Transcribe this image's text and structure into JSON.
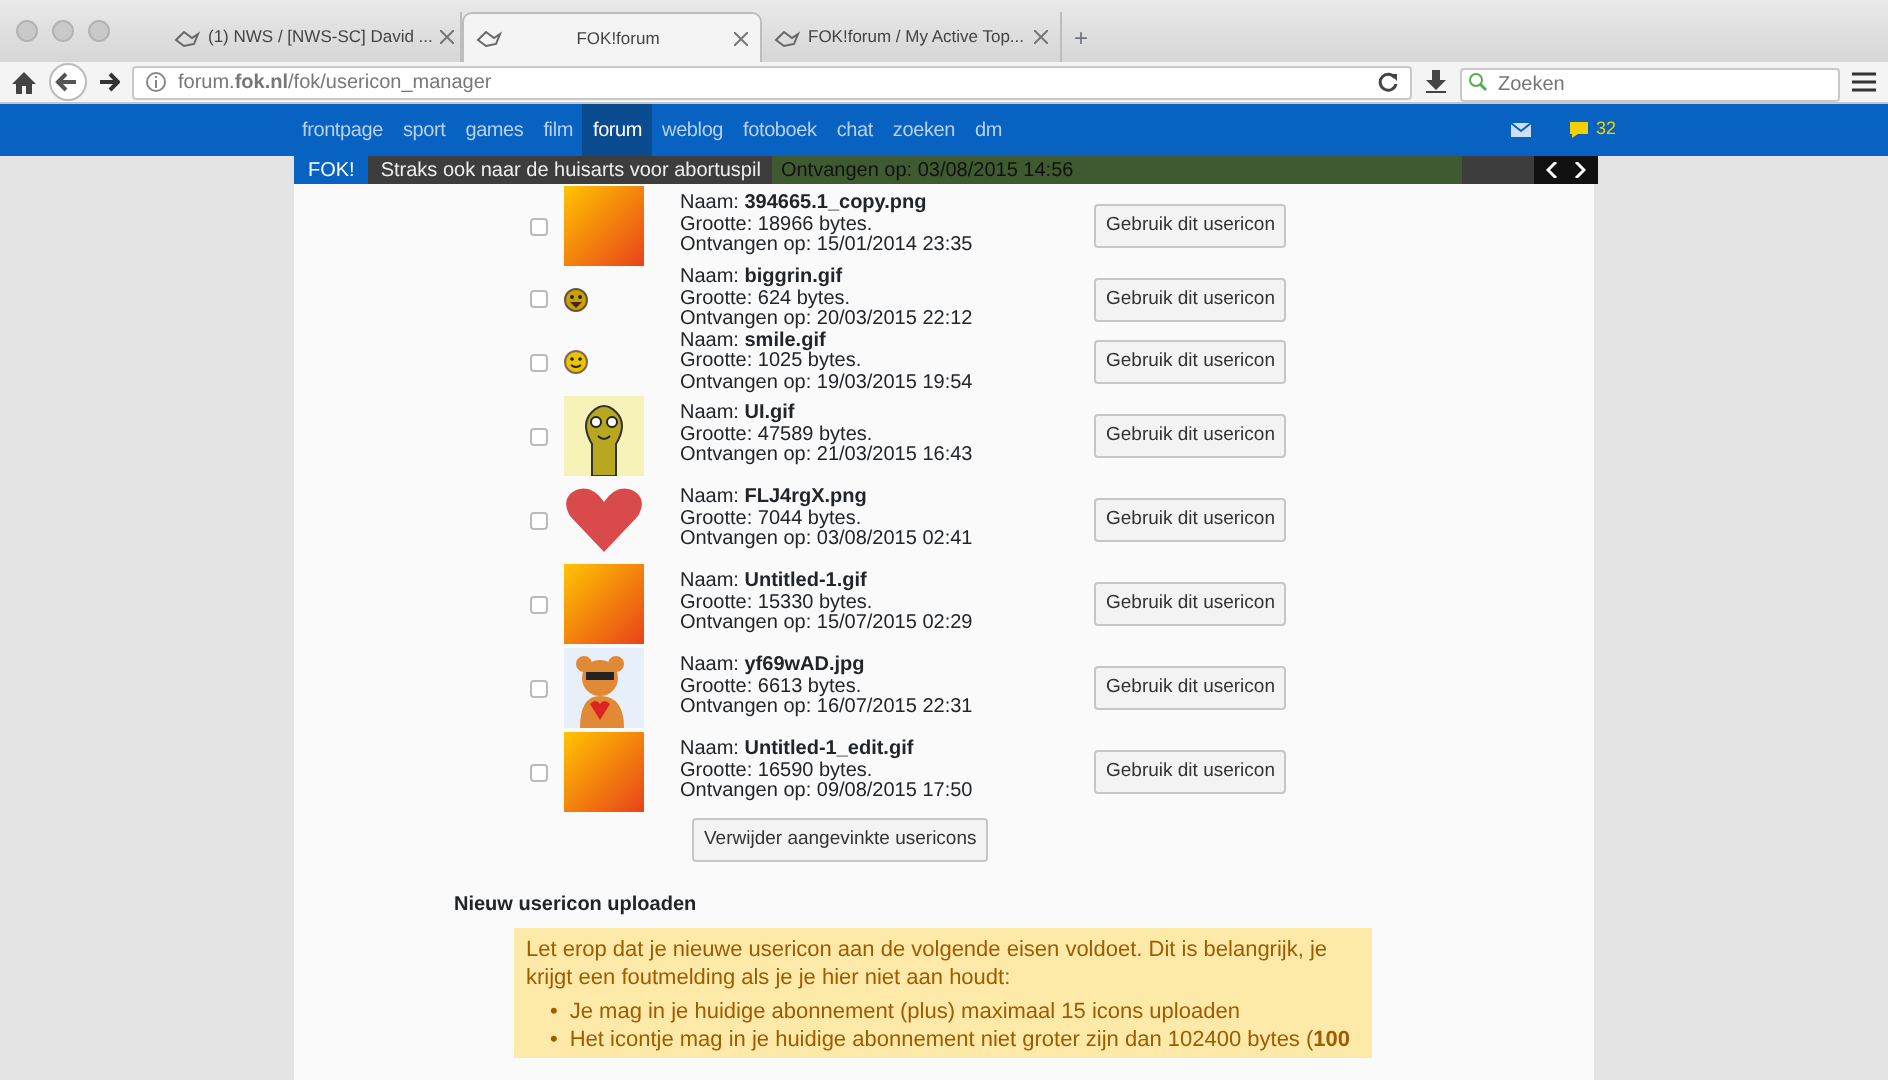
{
  "browser": {
    "tabs": [
      {
        "title": "(1) NWS / [NWS-SC] David ...",
        "selected": false
      },
      {
        "title": "FOK!forum",
        "selected": true
      },
      {
        "title": "FOK!forum / My Active Top...",
        "selected": false
      }
    ],
    "new_tab": "+",
    "url": "forum.**fok.nl**/fok/usericon_manager",
    "search": {
      "placeholder": "Zoeken"
    }
  },
  "nav": {
    "items": [
      {
        "label": "frontpage",
        "selected": false
      },
      {
        "label": "sport",
        "selected": false
      },
      {
        "label": "games",
        "selected": false
      },
      {
        "label": "film",
        "selected": false
      },
      {
        "label": "forum",
        "selected": true
      },
      {
        "label": "weblog",
        "selected": false
      },
      {
        "label": "fotoboek",
        "selected": false
      },
      {
        "label": "chat",
        "selected": false
      },
      {
        "label": "zoeken",
        "selected": false
      },
      {
        "label": "dm",
        "selected": false
      }
    ],
    "chat_count": "32"
  },
  "ticker": {
    "label": "FOK!",
    "headline": "Straks ook naar de huisarts voor abortuspil",
    "behind": "Ontvangen op: 03/08/2015 14:56"
  },
  "icons": [
    {
      "kind": "gradient",
      "checked": false,
      "name": "Naam: **394665.1_copy.png**",
      "size": "Grootte: 18966 bytes.",
      "received": "Ontvangen op: 15/01/2014 23:35",
      "button": "Gebruik dit usericon"
    },
    {
      "kind": "grin",
      "checked": false,
      "name": "Naam: **biggrin.gif**",
      "size": "Grootte: 624 bytes.",
      "received": "Ontvangen op: 20/03/2015 22:12",
      "button": "Gebruik dit usericon"
    },
    {
      "kind": "smile",
      "checked": false,
      "name": "Naam: **smile.gif**",
      "size": "Grootte: 1025 bytes.",
      "received": "Ontvangen op: 19/03/2015 19:54",
      "button": "Gebruik dit usericon"
    },
    {
      "kind": "snake",
      "checked": false,
      "name": "Naam: **UI.gif**",
      "size": "Grootte: 47589 bytes.",
      "received": "Ontvangen op: 21/03/2015 16:43",
      "button": "Gebruik dit usericon"
    },
    {
      "kind": "heart",
      "checked": false,
      "name": "Naam: **FLJ4rgX.png**",
      "size": "Grootte: 7044 bytes.",
      "received": "Ontvangen op: 03/08/2015 02:41",
      "button": "Gebruik dit usericon"
    },
    {
      "kind": "gradient",
      "checked": false,
      "name": "Naam: **Untitled-1.gif**",
      "size": "Grootte: 15330 bytes.",
      "received": "Ontvangen op: 15/07/2015 02:29",
      "button": "Gebruik dit usericon"
    },
    {
      "kind": "bear",
      "checked": false,
      "name": "Naam: **yf69wAD.jpg**",
      "size": "Grootte: 6613 bytes.",
      "received": "Ontvangen op: 16/07/2015 22:31",
      "button": "Gebruik dit usericon"
    },
    {
      "kind": "gradient",
      "checked": false,
      "name": "Naam: **Untitled-1_edit.gif**",
      "size": "Grootte: 16590 bytes.",
      "received": "Ontvangen op: 09/08/2015 17:50",
      "button": "Gebruik dit usericon"
    }
  ],
  "delete_button": "Verwijder aangevinkte usericons",
  "upload": {
    "heading": "Nieuw usericon uploaden",
    "notice": "Let erop dat je nieuwe usericon aan de volgende eisen voldoet. Dit is belangrijk, je krijgt een foutmelding als je je hier niet aan houdt:",
    "rules": [
      {
        "marker": "•",
        "text": "Je mag in je huidige abonnement (plus) maximaal 15 icons uploaden"
      },
      {
        "marker": "•",
        "text": "Het icontje mag in je huidige abonnement niet groter zijn dan 102400 bytes (**100**"
      }
    ]
  }
}
